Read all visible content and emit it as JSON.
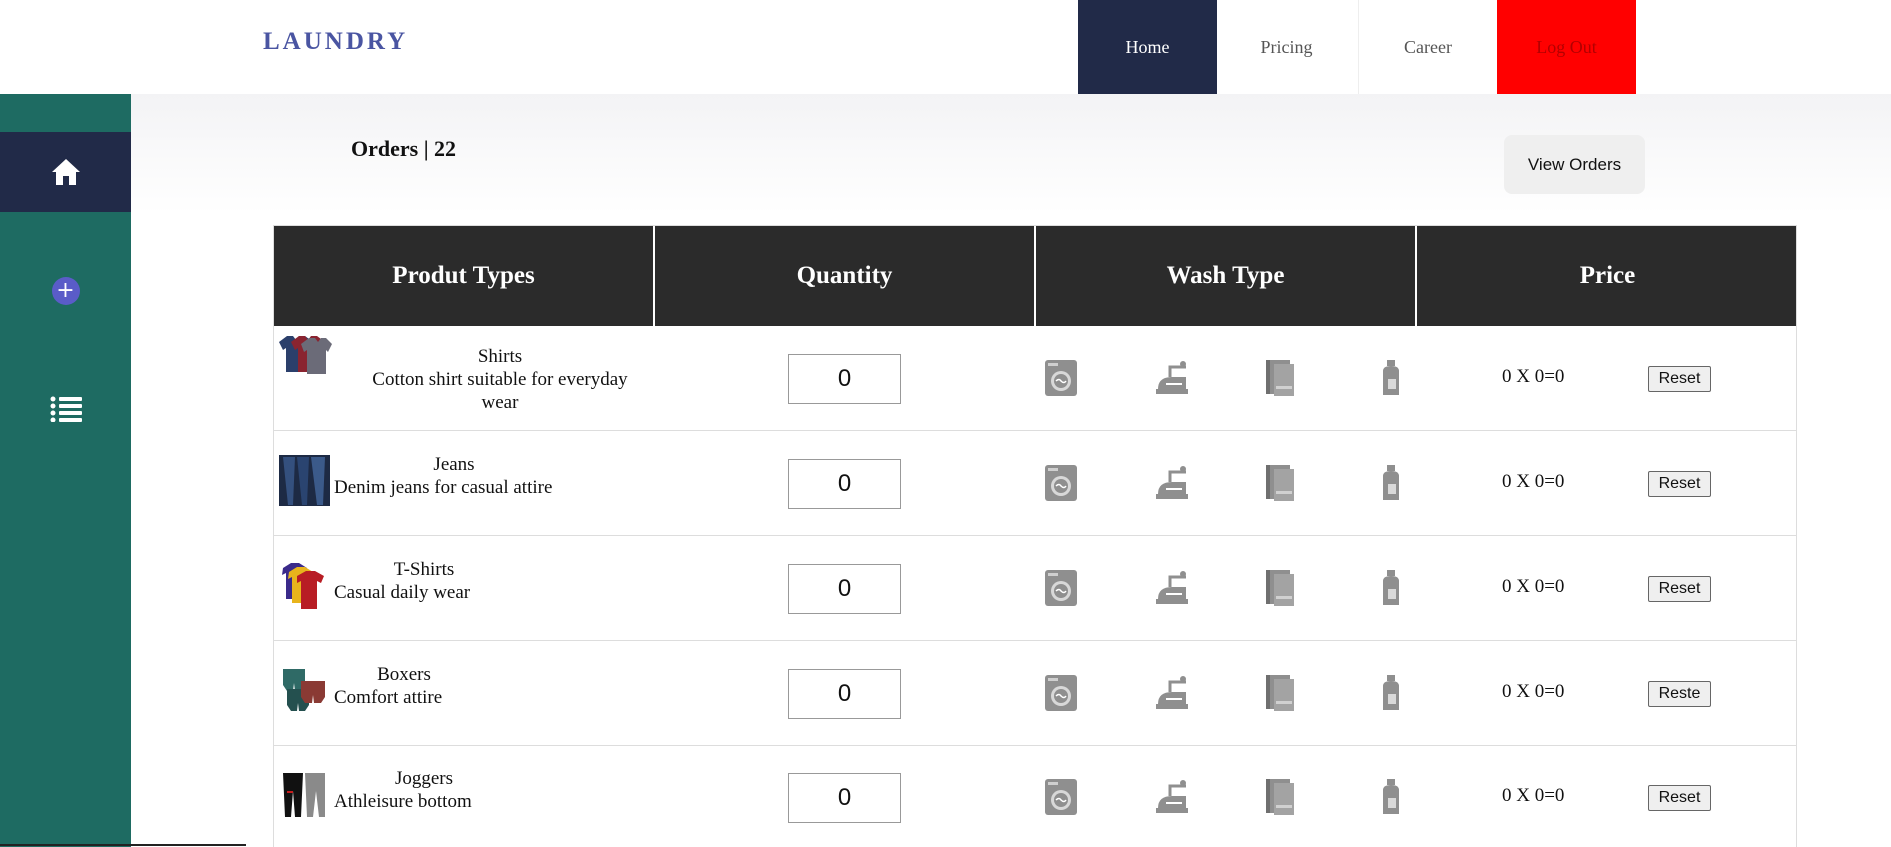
{
  "header": {
    "brand": "LAUNDRY",
    "nav": {
      "home": "Home",
      "pricing": "Pricing",
      "career": "Career",
      "logout": "Log Out"
    }
  },
  "sidebar": {
    "items": [
      {
        "icon": "home-icon"
      },
      {
        "icon": "add-circle-icon"
      },
      {
        "icon": "list-icon"
      }
    ]
  },
  "orders": {
    "title": "Orders | 22",
    "view_button": "View Orders"
  },
  "table": {
    "headers": [
      "Produt Types",
      "Quantity",
      "Wash Type",
      "Price"
    ],
    "wash_icons": [
      "washing-machine-icon",
      "iron-icon",
      "towel-icon",
      "bleach-bottle-icon"
    ],
    "rows": [
      {
        "name": "Shirts",
        "desc": "Cotton shirt suitable for everyday wear",
        "qty": "0",
        "price": "0 X 0=0",
        "reset": "Reset"
      },
      {
        "name": "Jeans",
        "desc": "Denim jeans for casual attire",
        "qty": "0",
        "price": "0 X 0=0",
        "reset": "Reset"
      },
      {
        "name": "T-Shirts",
        "desc": "Casual daily wear",
        "qty": "0",
        "price": "0 X 0=0",
        "reset": "Reset"
      },
      {
        "name": "Boxers",
        "desc": "Comfort attire",
        "qty": "0",
        "price": "0 X 0=0",
        "reset": "Reste"
      },
      {
        "name": "Joggers",
        "desc": "Athleisure bottom",
        "qty": "0",
        "price": "0 X 0=0",
        "reset": "Reset"
      }
    ]
  },
  "colors": {
    "nav_active": "#212a48",
    "logout": "#ff0000",
    "sidebar": "#1e6b62",
    "table_header": "#2b2b2b",
    "brand": "#4a55a2"
  }
}
